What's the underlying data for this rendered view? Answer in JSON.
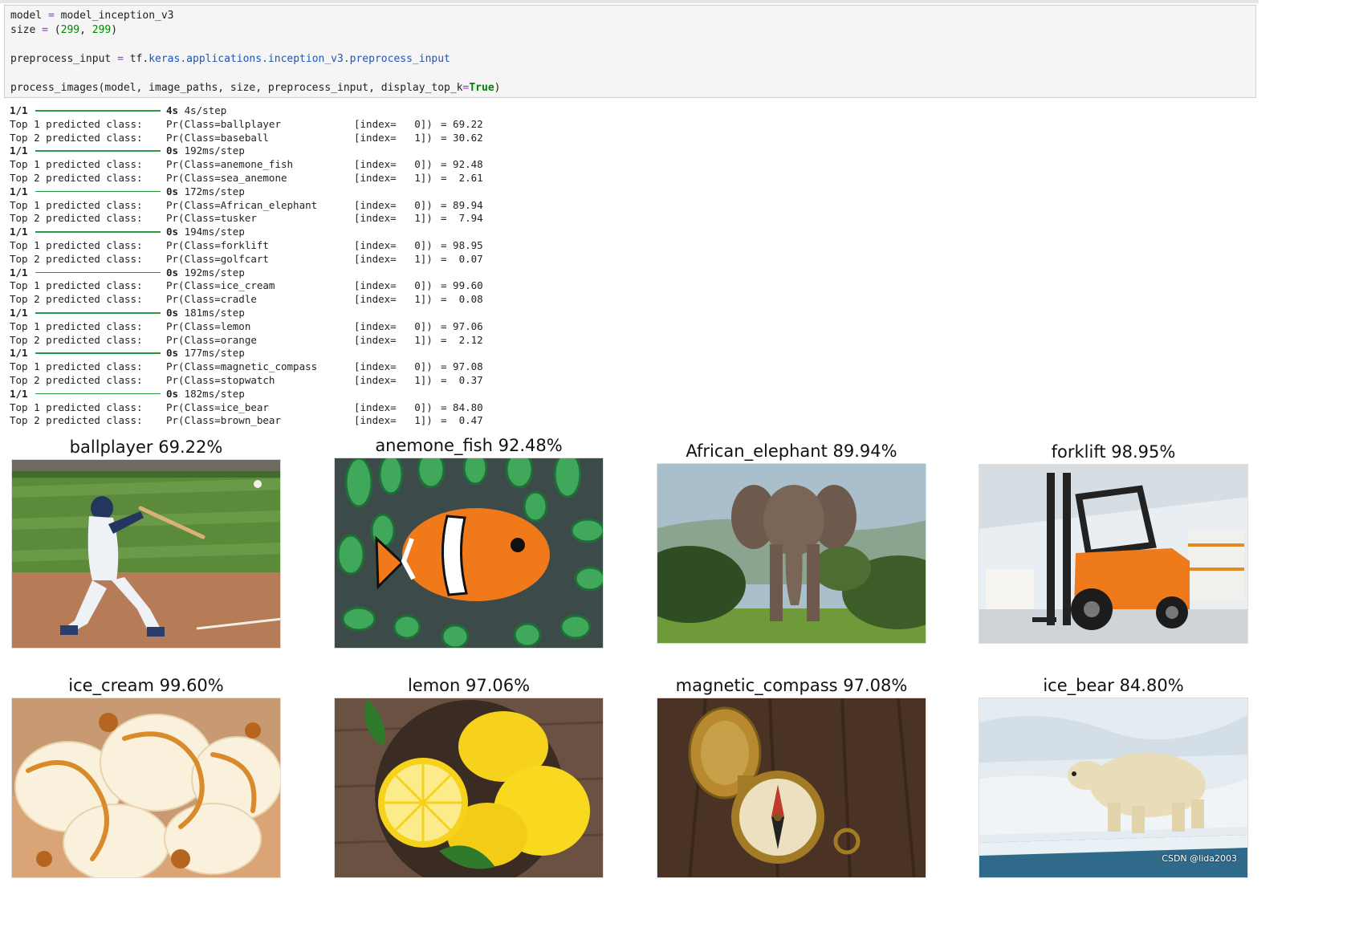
{
  "code": {
    "line1": {
      "a": "model ",
      "op": "=",
      "b": " model_inception_v3"
    },
    "line2": {
      "a": "size ",
      "op": "=",
      "b": " (",
      "n1": "299",
      "c": ", ",
      "n2": "299",
      "d": ")"
    },
    "line3": {
      "a": "preprocess_input ",
      "op": "=",
      "b": " tf.",
      "attr": "keras.applications.inception_v3.preprocess_input"
    },
    "line4": {
      "a": "process_images(model, image_paths, size, preprocess_input, display_top_k",
      "op": "=",
      "kw": "True",
      "b": ")"
    }
  },
  "output": {
    "steps": [
      {
        "count": "1/1",
        "time": "4s",
        "rate": "4s/step",
        "preds": [
          {
            "label": "Top 1 predicted class:",
            "cls": "Pr(Class=ballplayer",
            "idx": "[index=   0])",
            "val": "= 69.22"
          },
          {
            "label": "Top 2 predicted class:",
            "cls": "Pr(Class=baseball",
            "idx": "[index=   1])",
            "val": "= 30.62"
          }
        ]
      },
      {
        "count": "1/1",
        "time": "0s",
        "rate": "192ms/step",
        "preds": [
          {
            "label": "Top 1 predicted class:",
            "cls": "Pr(Class=anemone_fish",
            "idx": "[index=   0])",
            "val": "= 92.48"
          },
          {
            "label": "Top 2 predicted class:",
            "cls": "Pr(Class=sea_anemone",
            "idx": "[index=   1])",
            "val": "=  2.61"
          }
        ]
      },
      {
        "count": "1/1",
        "time": "0s",
        "rate": "172ms/step",
        "preds": [
          {
            "label": "Top 1 predicted class:",
            "cls": "Pr(Class=African_elephant",
            "idx": "[index=   0])",
            "val": "= 89.94"
          },
          {
            "label": "Top 2 predicted class:",
            "cls": "Pr(Class=tusker",
            "idx": "[index=   1])",
            "val": "=  7.94"
          }
        ]
      },
      {
        "count": "1/1",
        "time": "0s",
        "rate": "194ms/step",
        "preds": [
          {
            "label": "Top 1 predicted class:",
            "cls": "Pr(Class=forklift",
            "idx": "[index=   0])",
            "val": "= 98.95"
          },
          {
            "label": "Top 2 predicted class:",
            "cls": "Pr(Class=golfcart",
            "idx": "[index=   1])",
            "val": "=  0.07"
          }
        ]
      },
      {
        "count": "1/1",
        "time": "0s",
        "rate": "192ms/step",
        "preds": [
          {
            "label": "Top 1 predicted class:",
            "cls": "Pr(Class=ice_cream",
            "idx": "[index=   0])",
            "val": "= 99.60"
          },
          {
            "label": "Top 2 predicted class:",
            "cls": "Pr(Class=cradle",
            "idx": "[index=   1])",
            "val": "=  0.08"
          }
        ]
      },
      {
        "count": "1/1",
        "time": "0s",
        "rate": "181ms/step",
        "preds": [
          {
            "label": "Top 1 predicted class:",
            "cls": "Pr(Class=lemon",
            "idx": "[index=   0])",
            "val": "= 97.06"
          },
          {
            "label": "Top 2 predicted class:",
            "cls": "Pr(Class=orange",
            "idx": "[index=   1])",
            "val": "=  2.12"
          }
        ]
      },
      {
        "count": "1/1",
        "time": "0s",
        "rate": "177ms/step",
        "preds": [
          {
            "label": "Top 1 predicted class:",
            "cls": "Pr(Class=magnetic_compass",
            "idx": "[index=   0])",
            "val": "= 97.08"
          },
          {
            "label": "Top 2 predicted class:",
            "cls": "Pr(Class=stopwatch",
            "idx": "[index=   1])",
            "val": "=  0.37"
          }
        ]
      },
      {
        "count": "1/1",
        "time": "0s",
        "rate": "182ms/step",
        "preds": [
          {
            "label": "Top 1 predicted class:",
            "cls": "Pr(Class=ice_bear",
            "idx": "[index=   0])",
            "val": "= 84.80"
          },
          {
            "label": "Top 2 predicted class:",
            "cls": "Pr(Class=brown_bear",
            "idx": "[index=   1])",
            "val": "=  0.47"
          }
        ]
      }
    ]
  },
  "gallery": [
    {
      "title": "ballplayer 69.22%",
      "icon": "baseball-player-photo"
    },
    {
      "title": "anemone_fish 92.48%",
      "icon": "clownfish-photo"
    },
    {
      "title": "African_elephant 89.94%",
      "icon": "elephant-photo"
    },
    {
      "title": "forklift 98.95%",
      "icon": "forklift-photo"
    },
    {
      "title": "ice_cream 99.60%",
      "icon": "ice-cream-photo"
    },
    {
      "title": "lemon 97.06%",
      "icon": "lemon-photo"
    },
    {
      "title": "magnetic_compass 97.08%",
      "icon": "compass-photo"
    },
    {
      "title": "ice_bear 84.80%",
      "icon": "polar-bear-photo"
    }
  ],
  "watermark": "CSDN @lida2003",
  "colors": {
    "progress": "#2a9a47",
    "keyword": "#008000",
    "number": "#008800",
    "operator": "#aa22ff",
    "attribute": "#1f55b3"
  }
}
